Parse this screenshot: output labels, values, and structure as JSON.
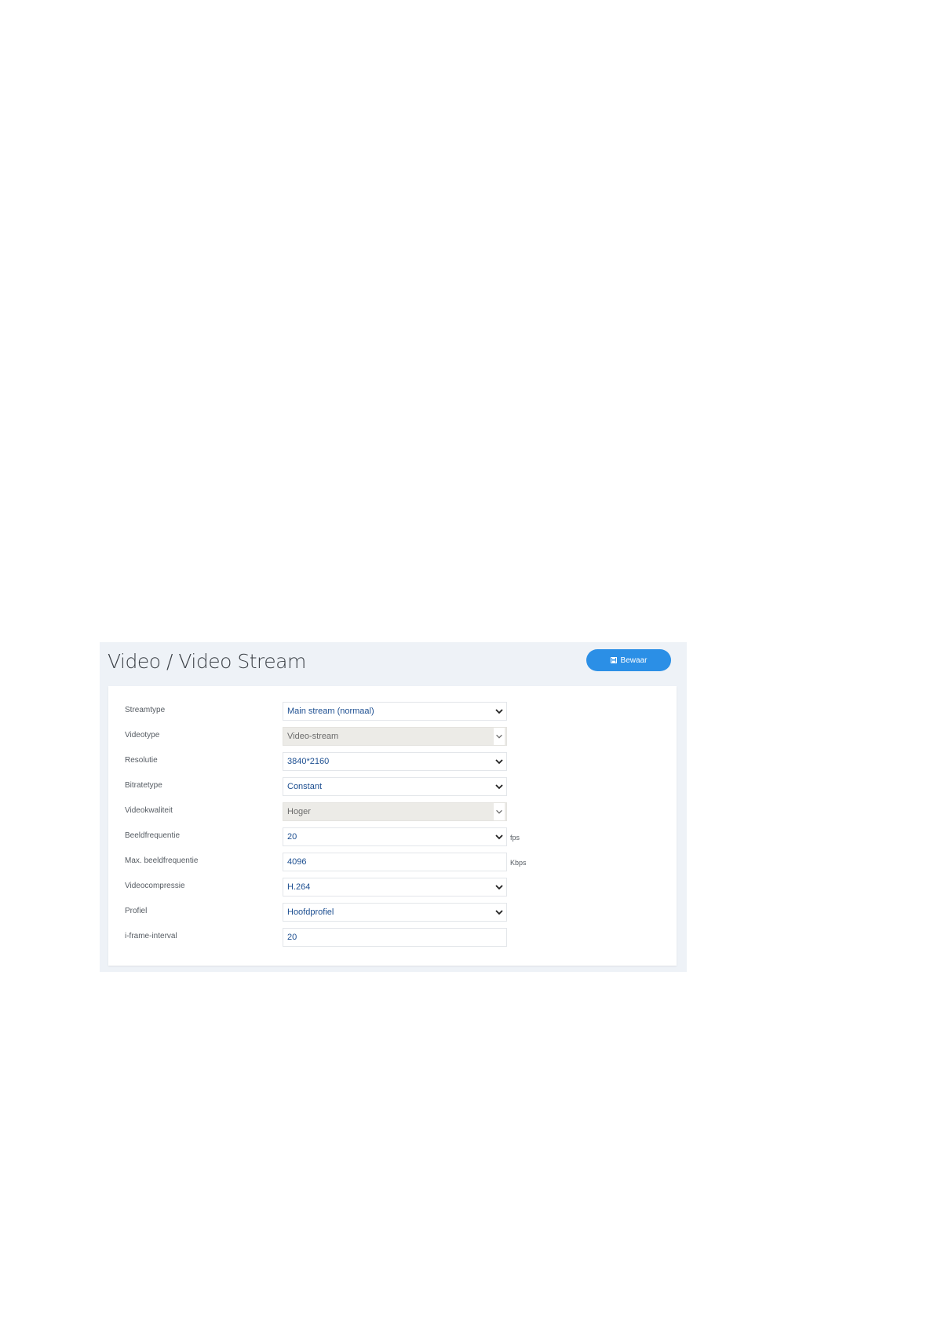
{
  "page": {
    "title": "Video / Video Stream"
  },
  "toolbar": {
    "save_label": "Bewaar"
  },
  "form": {
    "fields": [
      {
        "label": "Streamtype",
        "value": "Main stream (normaal)",
        "kind": "select",
        "disabled": false,
        "unit": ""
      },
      {
        "label": "Videotype",
        "value": "Video-stream",
        "kind": "select",
        "disabled": true,
        "unit": ""
      },
      {
        "label": "Resolutie",
        "value": "3840*2160",
        "kind": "select",
        "disabled": false,
        "unit": ""
      },
      {
        "label": "Bitratetype",
        "value": "Constant",
        "kind": "select",
        "disabled": false,
        "unit": ""
      },
      {
        "label": "Videokwaliteit",
        "value": "Hoger",
        "kind": "select",
        "disabled": true,
        "unit": ""
      },
      {
        "label": "Beeldfrequentie",
        "value": "20",
        "kind": "select",
        "disabled": false,
        "unit": "fps"
      },
      {
        "label": "Max. beeldfrequentie",
        "value": "4096",
        "kind": "input",
        "disabled": false,
        "unit": "Kbps"
      },
      {
        "label": "Videocompressie",
        "value": "H.264",
        "kind": "select",
        "disabled": false,
        "unit": ""
      },
      {
        "label": "Profiel",
        "value": "Hoofdprofiel",
        "kind": "select",
        "disabled": false,
        "unit": ""
      },
      {
        "label": "i-frame-interval",
        "value": "20",
        "kind": "input",
        "disabled": false,
        "unit": ""
      }
    ]
  },
  "colors": {
    "accent": "#2b8fe6",
    "value_text": "#1d4f91",
    "panel_bg": "#eef2f7",
    "disabled_bg": "#ecebe7"
  },
  "icons": {
    "save": "floppy-disk-icon",
    "dropdown": "chevron-down-icon"
  }
}
